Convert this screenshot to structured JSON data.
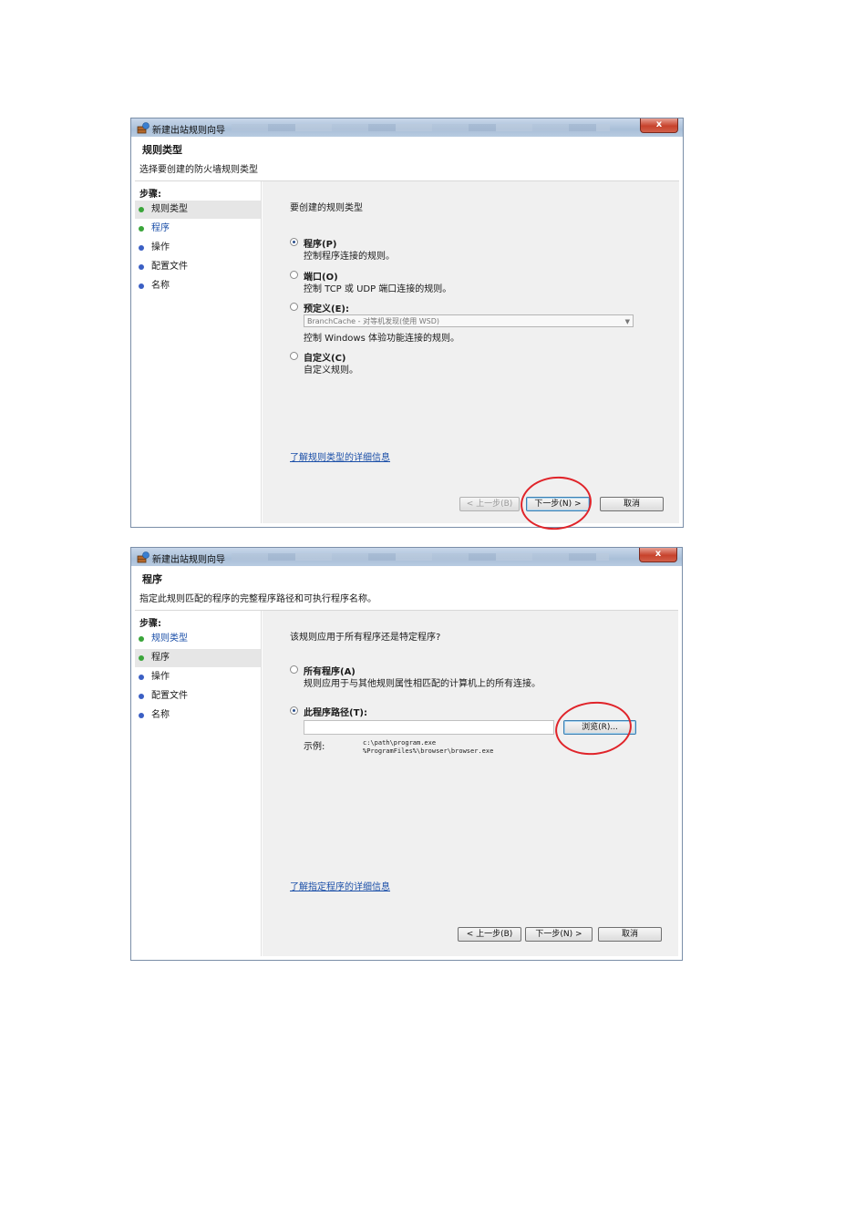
{
  "dialog1": {
    "title": "新建出站规则向导",
    "close_label": "x",
    "header_title": "规则类型",
    "header_desc": "选择要创建的防火墙规则类型",
    "steps_label": "步骤:",
    "steps": [
      "规则类型",
      "程序",
      "操作",
      "配置文件",
      "名称"
    ],
    "prompt": "要创建的规则类型",
    "options": [
      {
        "title": "程序(P)",
        "desc": "控制程序连接的规则。",
        "checked": true
      },
      {
        "title": "端口(O)",
        "desc": "控制 TCP 或 UDP 端口连接的规则。",
        "checked": false
      },
      {
        "title": "预定义(E):",
        "desc": "控制 Windows 体验功能连接的规则。",
        "checked": false
      },
      {
        "title": "自定义(C)",
        "desc": "自定义规则。",
        "checked": false
      }
    ],
    "predefined_value": "BranchCache - 对等机发现(使用 WSD)",
    "link": "了解规则类型的详细信息",
    "buttons": {
      "back": "< 上一步(B)",
      "next": "下一步(N) >",
      "cancel": "取消"
    }
  },
  "dialog2": {
    "title": "新建出站规则向导",
    "close_label": "x",
    "header_title": "程序",
    "header_desc": "指定此规则匹配的程序的完整程序路径和可执行程序名称。",
    "steps_label": "步骤:",
    "steps": [
      "规则类型",
      "程序",
      "操作",
      "配置文件",
      "名称"
    ],
    "prompt": "该规则应用于所有程序还是特定程序?",
    "options": [
      {
        "title": "所有程序(A)",
        "desc": "规则应用于与其他规则属性相匹配的计算机上的所有连接。",
        "checked": false
      },
      {
        "title": "此程序路径(T):",
        "desc": "",
        "checked": true
      }
    ],
    "path_value": "",
    "browse_label": "浏览(R)...",
    "example_label": "示例:",
    "example_lines": [
      "c:\\path\\program.exe",
      "%ProgramFiles%\\browser\\browser.exe"
    ],
    "link": "了解指定程序的详细信息",
    "buttons": {
      "back": "< 上一步(B)",
      "next": "下一步(N) >",
      "cancel": "取消"
    }
  },
  "colors": {
    "active_dot": "#3aa53a",
    "inactive_dot": "#3b5fc4",
    "link": "#1b4fa8",
    "annotation": "#e0242a"
  }
}
